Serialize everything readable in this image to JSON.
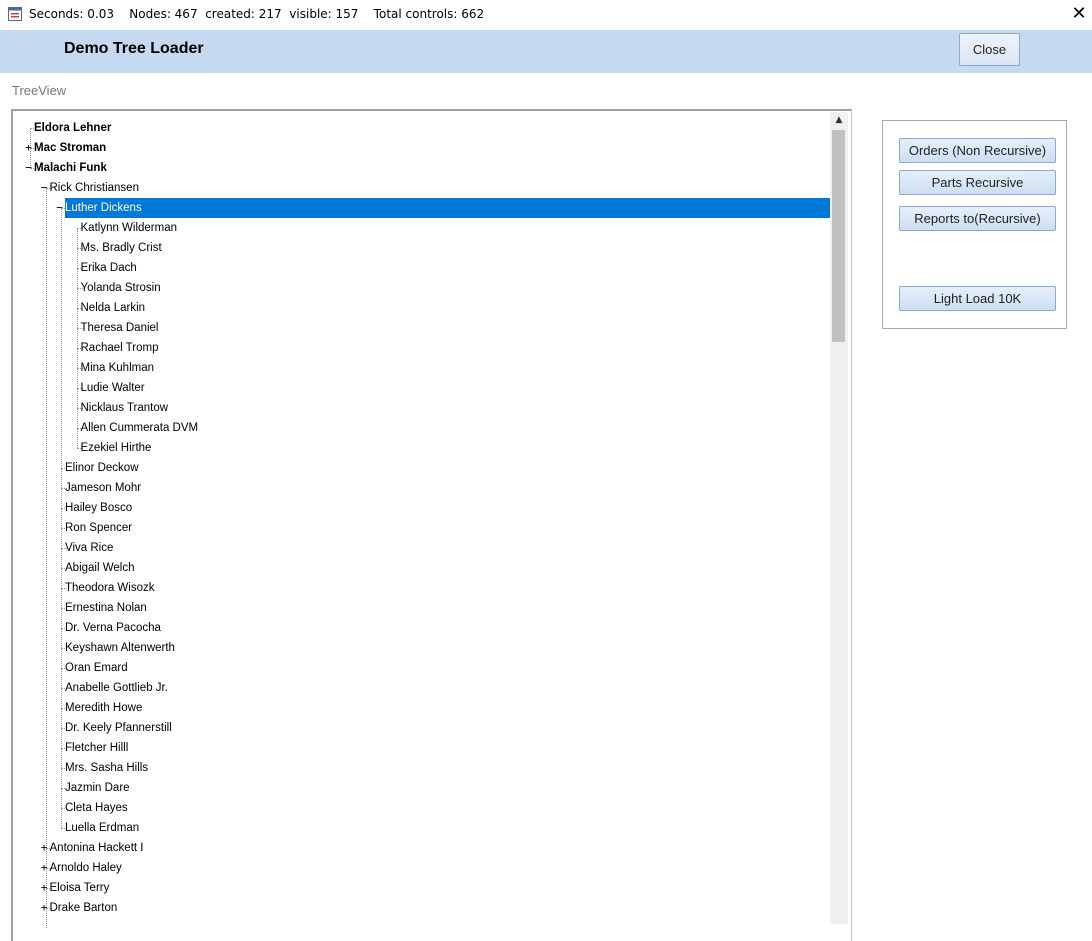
{
  "titlebar": {
    "status_text": "Seconds: 0.03    Nodes: 467  created: 217  visible: 157    Total controls: 662",
    "close_glyph": "✕"
  },
  "header": {
    "title": "Demo Tree Loader",
    "close_label": "Close"
  },
  "treeview_label": "TreeView",
  "tree": {
    "selected": "Luther Dickens",
    "nodes": [
      {
        "label": "Eldora Lehner",
        "level": 0,
        "bold": true,
        "expander": ""
      },
      {
        "label": "Mac Stroman",
        "level": 0,
        "bold": true,
        "expander": "+"
      },
      {
        "label": "Malachi Funk",
        "level": 0,
        "bold": true,
        "expander": "−"
      },
      {
        "label": "Rick Christiansen",
        "level": 1,
        "expander": "−"
      },
      {
        "label": "Luther Dickens",
        "level": 2,
        "expander": "−",
        "selected": true
      },
      {
        "label": "Katlynn Wilderman",
        "level": 3,
        "expander": ""
      },
      {
        "label": "Ms. Bradly Crist",
        "level": 3,
        "expander": ""
      },
      {
        "label": "Erika Dach",
        "level": 3,
        "expander": ""
      },
      {
        "label": "Yolanda Strosin",
        "level": 3,
        "expander": ""
      },
      {
        "label": "Nelda Larkin",
        "level": 3,
        "expander": ""
      },
      {
        "label": "Theresa Daniel",
        "level": 3,
        "expander": ""
      },
      {
        "label": "Rachael Tromp",
        "level": 3,
        "expander": ""
      },
      {
        "label": "Mina Kuhlman",
        "level": 3,
        "expander": ""
      },
      {
        "label": "Ludie Walter",
        "level": 3,
        "expander": ""
      },
      {
        "label": "Nicklaus Trantow",
        "level": 3,
        "expander": ""
      },
      {
        "label": "Allen Cummerata DVM",
        "level": 3,
        "expander": ""
      },
      {
        "label": "Ezekiel Hirthe",
        "level": 3,
        "expander": ""
      },
      {
        "label": "Elinor Deckow",
        "level": 2,
        "expander": ""
      },
      {
        "label": "Jameson Mohr",
        "level": 2,
        "expander": ""
      },
      {
        "label": "Hailey Bosco",
        "level": 2,
        "expander": ""
      },
      {
        "label": "Ron Spencer",
        "level": 2,
        "expander": ""
      },
      {
        "label": "Viva Rice",
        "level": 2,
        "expander": ""
      },
      {
        "label": "Abigail Welch",
        "level": 2,
        "expander": ""
      },
      {
        "label": "Theodora Wisozk",
        "level": 2,
        "expander": ""
      },
      {
        "label": "Ernestina Nolan",
        "level": 2,
        "expander": ""
      },
      {
        "label": "Dr. Verna Pacocha",
        "level": 2,
        "expander": ""
      },
      {
        "label": "Keyshawn Altenwerth",
        "level": 2,
        "expander": ""
      },
      {
        "label": "Oran Emard",
        "level": 2,
        "expander": ""
      },
      {
        "label": "Anabelle Gottlieb Jr.",
        "level": 2,
        "expander": ""
      },
      {
        "label": "Meredith Howe",
        "level": 2,
        "expander": ""
      },
      {
        "label": "Dr. Keely Pfannerstill",
        "level": 2,
        "expander": ""
      },
      {
        "label": "Fletcher Hilll",
        "level": 2,
        "expander": ""
      },
      {
        "label": "Mrs. Sasha Hills",
        "level": 2,
        "expander": ""
      },
      {
        "label": "Jazmin Dare",
        "level": 2,
        "expander": ""
      },
      {
        "label": "Cleta Hayes",
        "level": 2,
        "expander": ""
      },
      {
        "label": "Luella Erdman",
        "level": 2,
        "expander": ""
      },
      {
        "label": "Antonina Hackett I",
        "level": 1,
        "expander": "+"
      },
      {
        "label": "Arnoldo Haley",
        "level": 1,
        "expander": "+"
      },
      {
        "label": "Eloisa Terry",
        "level": 1,
        "expander": "+"
      },
      {
        "label": "Drake Barton",
        "level": 1,
        "expander": "+"
      }
    ]
  },
  "scrollbar": {
    "up_glyph": "▲"
  },
  "buttons": {
    "orders": "Orders (Non Recursive)",
    "parts": "Parts Recursive",
    "reports": "Reports to(Recursive)",
    "light_load": "Light Load 10K"
  }
}
